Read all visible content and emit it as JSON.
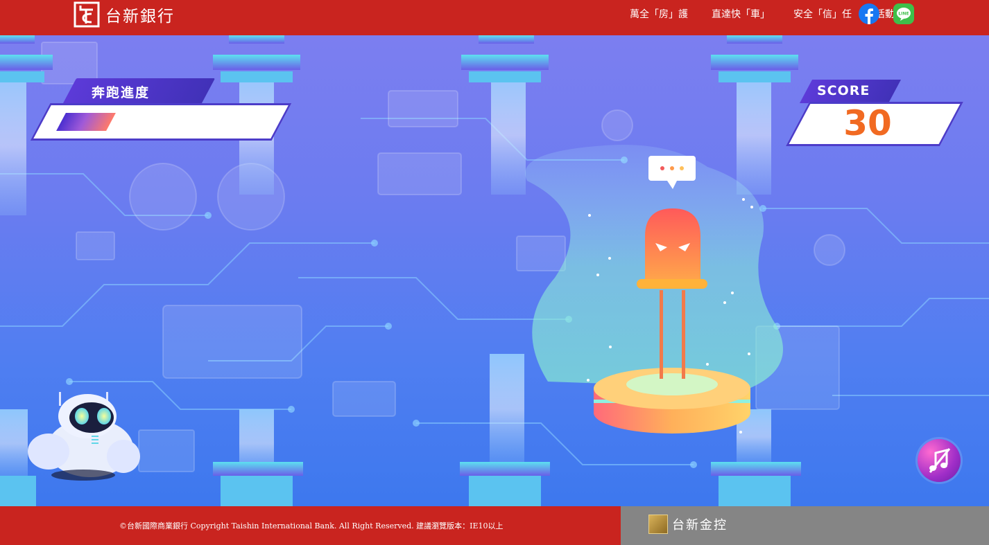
{
  "header": {
    "brand_name": "台新銀行",
    "nav": [
      {
        "label": "萬全「房」護"
      },
      {
        "label": "直達快「車」"
      },
      {
        "label": "安全「信」任"
      },
      {
        "label": "活動辦法"
      }
    ],
    "line_badge_text": "LINE"
  },
  "game": {
    "progress_label": "奔跑進度",
    "progress_fraction": 0.3,
    "score_label": "SCORE",
    "score_value": "30"
  },
  "footer": {
    "copyright": "©台新國際商業銀行 Copyright Taishin International Bank. All Right Reserved.  建議瀏覽版本：IE10以上",
    "holding_name": "台新金控"
  },
  "colors": {
    "brand_red": "#c9241f",
    "score_orange": "#f16a22",
    "panel_purple": "#4c3cc9",
    "footer_gray": "#858585"
  },
  "icons": [
    "taishin-logo-icon",
    "facebook-icon",
    "line-icon",
    "speech-bubble-icon",
    "led-character-icon",
    "robot-icon",
    "music-note-icon",
    "taishin-holding-logo-icon"
  ]
}
